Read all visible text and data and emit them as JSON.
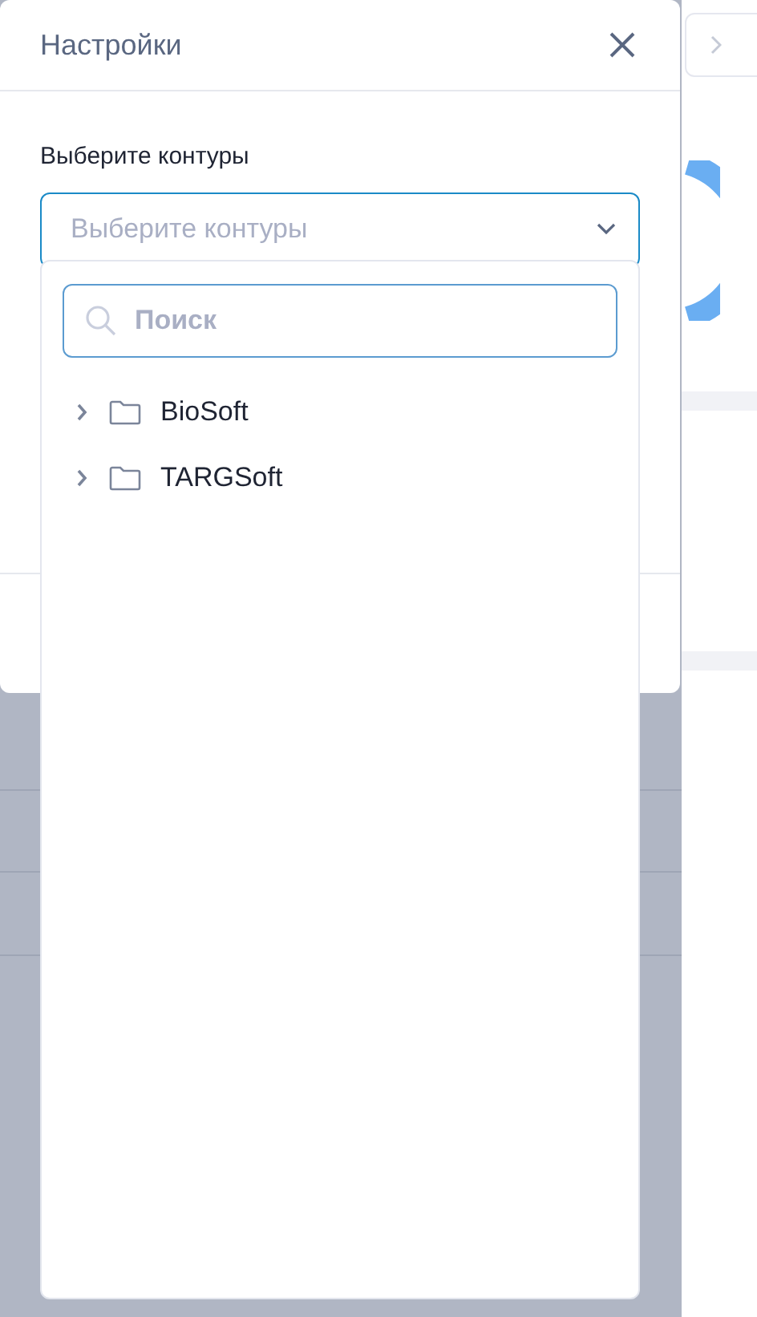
{
  "dialog": {
    "title": "Настройки",
    "field_label": "Выберите контуры",
    "select": {
      "placeholder": "Выберите контуры",
      "expanded": true
    }
  },
  "dropdown": {
    "search": {
      "placeholder": "Поиск"
    },
    "tree": [
      {
        "label": "BioSoft",
        "expanded": false
      },
      {
        "label": "TARGSoft",
        "expanded": false
      }
    ]
  }
}
